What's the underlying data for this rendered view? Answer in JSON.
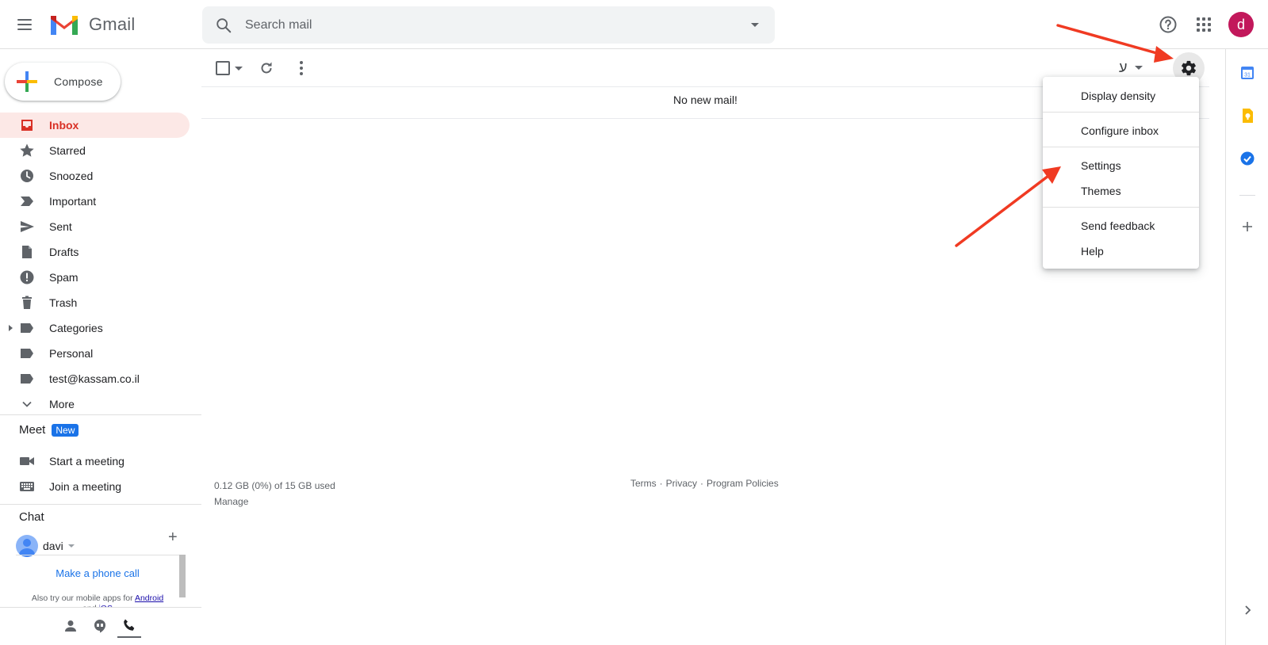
{
  "header": {
    "app_name": "Gmail",
    "search_placeholder": "Search mail",
    "avatar_initial": "d"
  },
  "sidebar": {
    "compose_label": "Compose",
    "items": [
      {
        "label": "Inbox",
        "icon": "inbox-icon",
        "active": true
      },
      {
        "label": "Starred",
        "icon": "star-icon"
      },
      {
        "label": "Snoozed",
        "icon": "clock-icon"
      },
      {
        "label": "Important",
        "icon": "important-icon"
      },
      {
        "label": "Sent",
        "icon": "send-icon"
      },
      {
        "label": "Drafts",
        "icon": "draft-icon"
      },
      {
        "label": "Spam",
        "icon": "spam-icon"
      },
      {
        "label": "Trash",
        "icon": "trash-icon"
      },
      {
        "label": "Categories",
        "icon": "label-icon"
      },
      {
        "label": "Personal",
        "icon": "label-icon"
      },
      {
        "label": "test@kassam.co.il",
        "icon": "label-icon"
      },
      {
        "label": "More",
        "icon": "chevron-down-icon"
      }
    ],
    "meet": {
      "title": "Meet",
      "badge": "New",
      "start": "Start a meeting",
      "join": "Join a meeting"
    },
    "chat": {
      "title": "Chat",
      "user": "davi",
      "phone_call": "Make a phone call",
      "mobile_prefix": "Also try our mobile apps for",
      "android": "Android",
      "and": "and",
      "ios": "iOS"
    }
  },
  "toolbar": {
    "input_tool_char": "ע"
  },
  "main": {
    "empty_message": "No new mail!",
    "storage": "0.12 GB (0%) of 15 GB used",
    "manage": "Manage",
    "footer": {
      "terms": "Terms",
      "privacy": "Privacy",
      "policies": "Program Policies",
      "sep": "·"
    }
  },
  "settings_menu": {
    "display_density": "Display density",
    "configure_inbox": "Configure inbox",
    "settings": "Settings",
    "themes": "Themes",
    "send_feedback": "Send feedback",
    "help": "Help"
  },
  "side_panel": {
    "calendar_day": "31"
  },
  "colors": {
    "accent_red": "#d93025",
    "active_bg": "#fce8e6",
    "link_blue": "#1a73e8",
    "annotation_arrow": "#f03a22"
  }
}
